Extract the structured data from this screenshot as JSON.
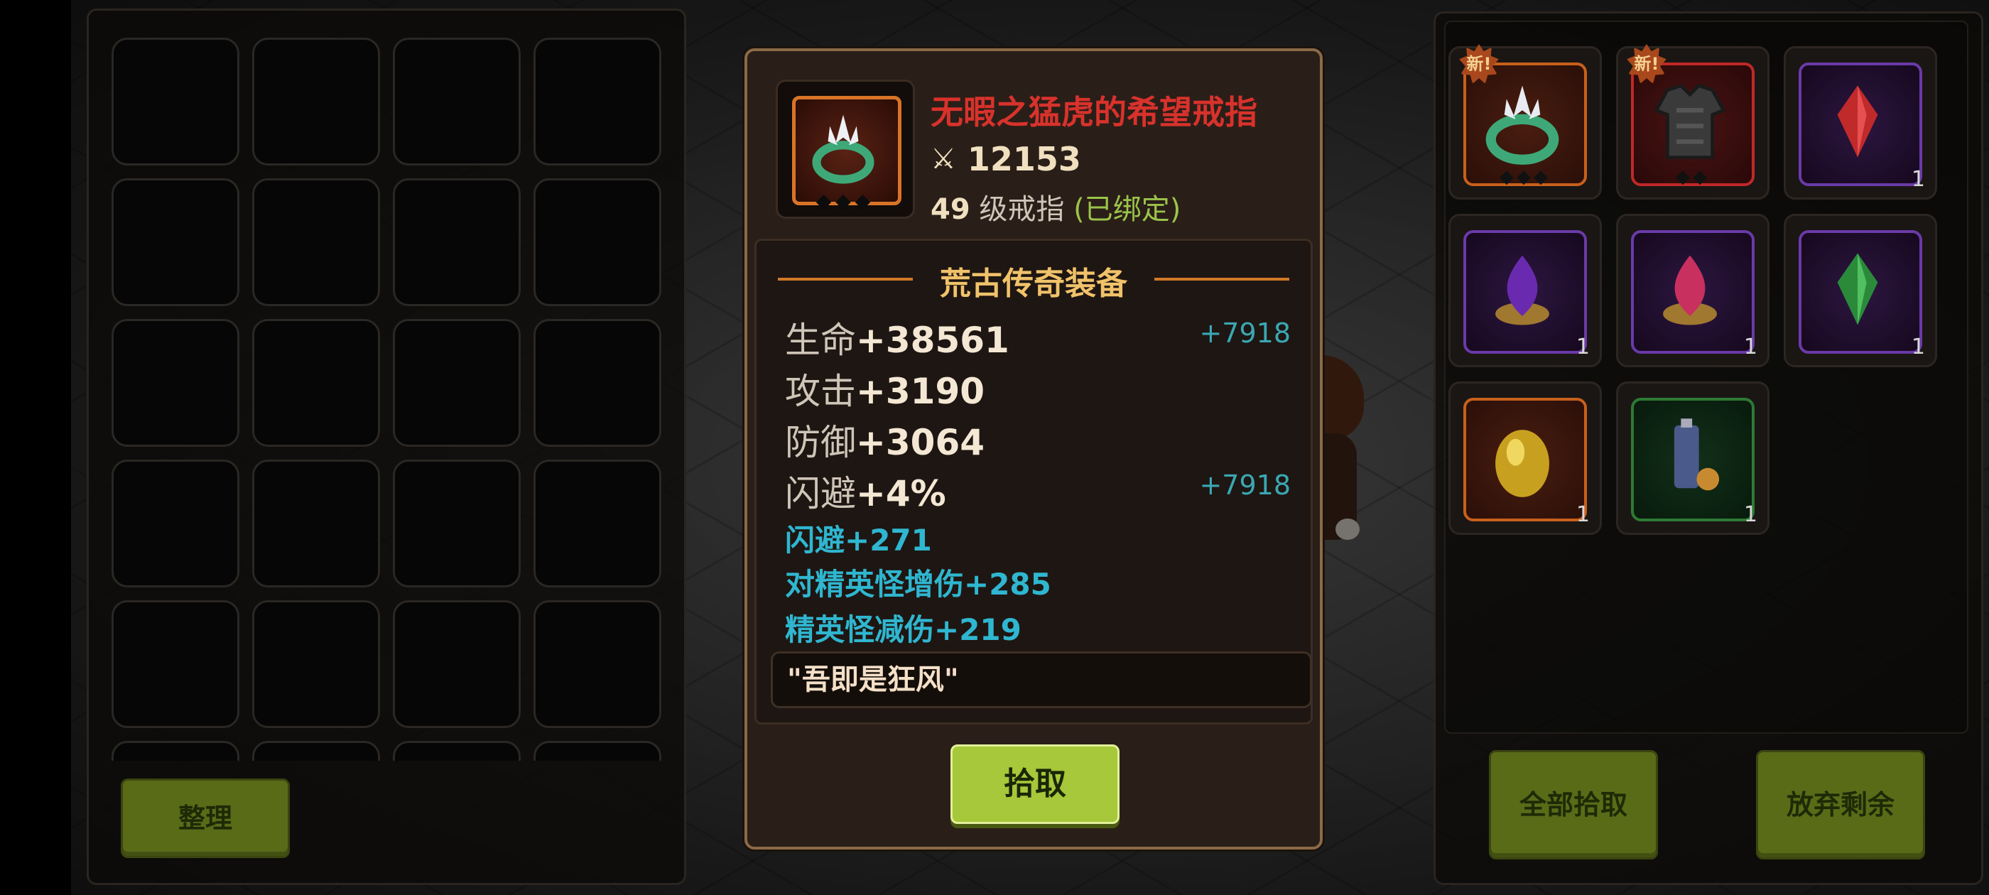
{
  "bag": {
    "sort_label": "整理",
    "slot_count": 24
  },
  "tooltip": {
    "item_name": "无暇之猛虎的希望戒指",
    "item_icon": "jade-ring-icon",
    "power_icon": "crossed-swords-icon",
    "power": "12153",
    "level": "49",
    "item_type": "级戒指",
    "bound_status": "(已绑定)",
    "tier_title": "荒古传奇装备",
    "stats": [
      {
        "label": "生命",
        "value": "+38561",
        "bonus": "+7918"
      },
      {
        "label": "攻击",
        "value": "+3190",
        "bonus": ""
      },
      {
        "label": "防御",
        "value": "+3064",
        "bonus": ""
      },
      {
        "label": "闪避",
        "value": "+4%",
        "bonus": "+7918"
      }
    ],
    "sub_stats": [
      "闪避+271",
      "对精英怪增伤+285",
      "精英怪减伤+219"
    ],
    "quote": "\"吾即是狂风\"",
    "pick_label": "拾取"
  },
  "loot": {
    "items": [
      {
        "icon": "jade-ring-icon",
        "rarity": "orange",
        "badge": "新!",
        "count": ""
      },
      {
        "icon": "chest-armor-icon",
        "rarity": "red",
        "badge": "新!",
        "count": ""
      },
      {
        "icon": "red-crystal-icon",
        "rarity": "purple",
        "badge": "",
        "count": "1"
      },
      {
        "icon": "purple-gem-icon",
        "rarity": "purple",
        "badge": "",
        "count": "1"
      },
      {
        "icon": "pink-gem-icon",
        "rarity": "purple",
        "badge": "",
        "count": "1"
      },
      {
        "icon": "green-crystal-icon",
        "rarity": "purple",
        "badge": "",
        "count": "1"
      },
      {
        "icon": "golden-egg-icon",
        "rarity": "orange",
        "badge": "",
        "count": "1"
      },
      {
        "icon": "battery-paw-icon",
        "rarity": "green",
        "badge": "",
        "count": "1"
      }
    ],
    "pick_all_label": "全部拾取",
    "discard_label": "放弃剩余"
  },
  "colors": {
    "legend_red": "#d8322c",
    "tier_gold": "#f0c26a",
    "sub_stat_cyan": "#2fb6d0",
    "button_green": "#a6c83a"
  }
}
